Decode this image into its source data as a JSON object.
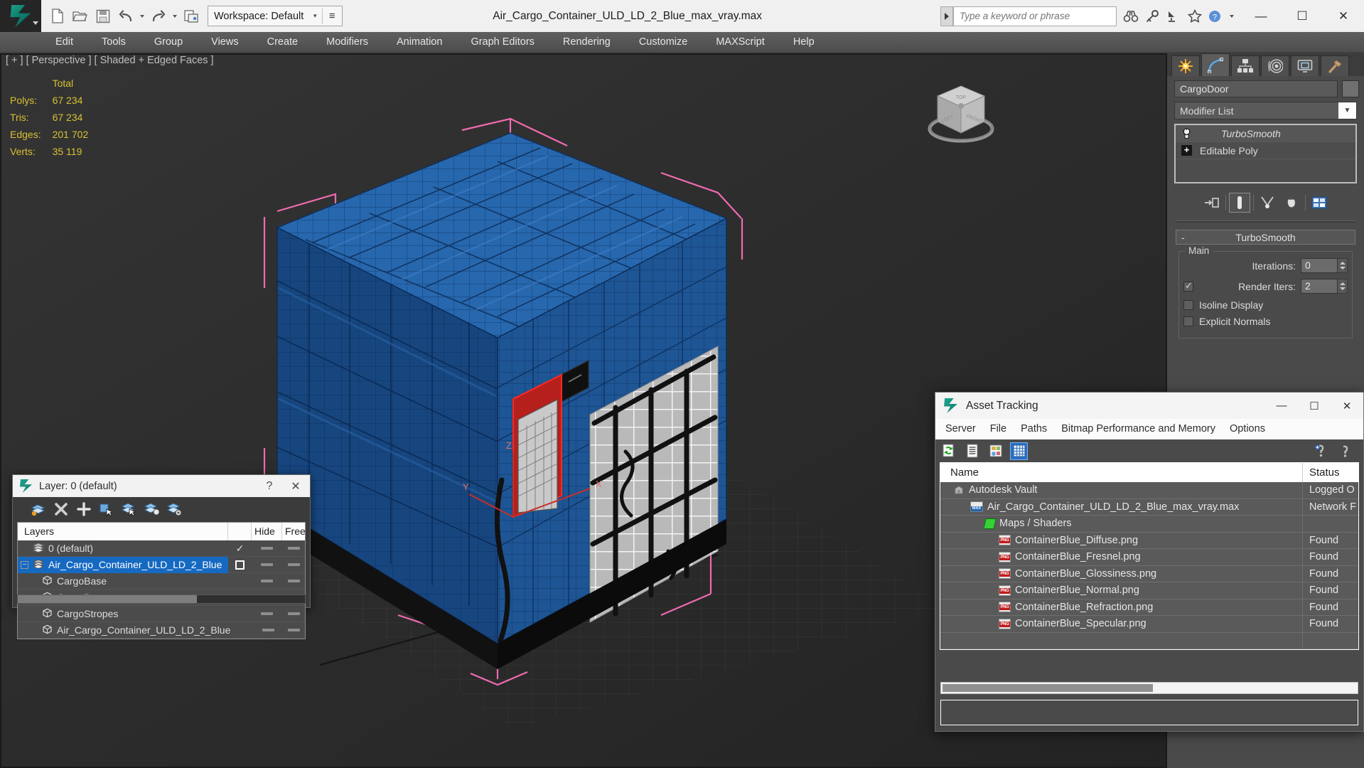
{
  "titlebar": {
    "workspace_label": "Workspace: Default",
    "document_title": "Air_Cargo_Container_ULD_LD_2_Blue_max_vray.max",
    "search_placeholder": "Type a keyword or phrase",
    "window_buttons": {
      "minimize": "—",
      "maximize": "☐",
      "close": "✕"
    }
  },
  "menubar": {
    "items": [
      "Edit",
      "Tools",
      "Group",
      "Views",
      "Create",
      "Modifiers",
      "Animation",
      "Graph Editors",
      "Rendering",
      "Customize",
      "MAXScript",
      "Help"
    ]
  },
  "viewport": {
    "label": "[ + ] [ Perspective ] [ Shaded + Edged Faces ]",
    "stats": {
      "header": "Total",
      "rows": [
        {
          "label": "Polys:",
          "value": "67 234"
        },
        {
          "label": "Tris:",
          "value": "67 234"
        },
        {
          "label": "Edges:",
          "value": "201 702"
        },
        {
          "label": "Verts:",
          "value": "35 119"
        }
      ]
    },
    "gizmo_axes": {
      "x": "X",
      "y": "Y",
      "z": "Z"
    }
  },
  "command_panel": {
    "tabs": [
      {
        "name": "create-tab",
        "icon": "star-icon"
      },
      {
        "name": "modify-tab",
        "icon": "curve-icon",
        "active": true
      },
      {
        "name": "hierarchy-tab",
        "icon": "hierarchy-icon"
      },
      {
        "name": "motion-tab",
        "icon": "motion-icon"
      },
      {
        "name": "display-tab",
        "icon": "display-icon"
      },
      {
        "name": "utilities-tab",
        "icon": "hammer-icon"
      }
    ],
    "object_name": "CargoDoor",
    "modifier_list_label": "Modifier List",
    "modifier_stack": [
      {
        "label": "TurboSmooth",
        "italic": true,
        "active": true,
        "icon": "bulb-icon"
      },
      {
        "label": "Editable Poly",
        "italic": false,
        "active": false,
        "icon": "plus-icon"
      }
    ],
    "rollout": {
      "title": "TurboSmooth",
      "collapse_glyph": "-",
      "group_title": "Main",
      "params": [
        {
          "label": "Iterations:",
          "value": "0",
          "checkbox": null
        },
        {
          "label": "Render Iters:",
          "value": "2",
          "checkbox": true
        }
      ],
      "checkboxes": [
        {
          "label": "Isoline Display",
          "checked": false
        },
        {
          "label": "Explicit Normals",
          "checked": false
        }
      ]
    }
  },
  "layer_dialog": {
    "title": "Layer: 0 (default)",
    "help_glyph": "?",
    "close_glyph": "✕",
    "columns": {
      "layers": "Layers",
      "hide": "Hide",
      "freeze": "Free"
    },
    "rows": [
      {
        "label": "0 (default)",
        "indent": 0,
        "icon": "layer-icon",
        "selected": false,
        "expander": false,
        "check": "✓"
      },
      {
        "label": "Air_Cargo_Container_ULD_LD_2_Blue",
        "indent": 0,
        "icon": "layer-icon",
        "selected": true,
        "expander": true,
        "check": "box"
      },
      {
        "label": "CargoBase",
        "indent": 1,
        "icon": "object-icon",
        "selected": false,
        "expander": false,
        "check": ""
      },
      {
        "label": "CargoDoor",
        "indent": 1,
        "icon": "object-icon",
        "selected": false,
        "expander": false,
        "check": ""
      },
      {
        "label": "CargoStropes",
        "indent": 1,
        "icon": "object-icon",
        "selected": false,
        "expander": false,
        "check": ""
      },
      {
        "label": "Air_Cargo_Container_ULD_LD_2_Blue",
        "indent": 1,
        "icon": "object-icon",
        "selected": false,
        "expander": false,
        "check": ""
      }
    ]
  },
  "asset_tracking": {
    "title": "Asset Tracking",
    "window_buttons": {
      "minimize": "—",
      "maximize": "☐",
      "close": "✕"
    },
    "menus": [
      "Server",
      "File",
      "Paths",
      "Bitmap Performance and Memory",
      "Options"
    ],
    "columns": {
      "name": "Name",
      "status": "Status"
    },
    "rows": [
      {
        "name": "Autodesk Vault",
        "status": "Logged O",
        "indent": 0,
        "icon": "vault-icon"
      },
      {
        "name": "Air_Cargo_Container_ULD_LD_2_Blue_max_vray.max",
        "status": "Network F",
        "indent": 1,
        "icon": "max-icon"
      },
      {
        "name": "Maps / Shaders",
        "status": "",
        "indent": 2,
        "icon": "maps-icon"
      },
      {
        "name": "ContainerBlue_Diffuse.png",
        "status": "Found",
        "indent": 3,
        "icon": "png-icon"
      },
      {
        "name": "ContainerBlue_Fresnel.png",
        "status": "Found",
        "indent": 3,
        "icon": "png-icon"
      },
      {
        "name": "ContainerBlue_Glossiness.png",
        "status": "Found",
        "indent": 3,
        "icon": "png-icon"
      },
      {
        "name": "ContainerBlue_Normal.png",
        "status": "Found",
        "indent": 3,
        "icon": "png-icon"
      },
      {
        "name": "ContainerBlue_Refraction.png",
        "status": "Found",
        "indent": 3,
        "icon": "png-icon"
      },
      {
        "name": "ContainerBlue_Specular.png",
        "status": "Found",
        "indent": 3,
        "icon": "png-icon"
      },
      {
        "name": "",
        "status": "",
        "indent": 0,
        "icon": ""
      }
    ]
  },
  "colors": {
    "accent_blue": "#1669c1",
    "stats_yellow": "#d8c132",
    "viewport_bg": "#2b2b2b",
    "panel_gray": "#4a4a4a",
    "model_blue": "#1f5fa8",
    "gizmo_pink": "#f06bb0"
  }
}
